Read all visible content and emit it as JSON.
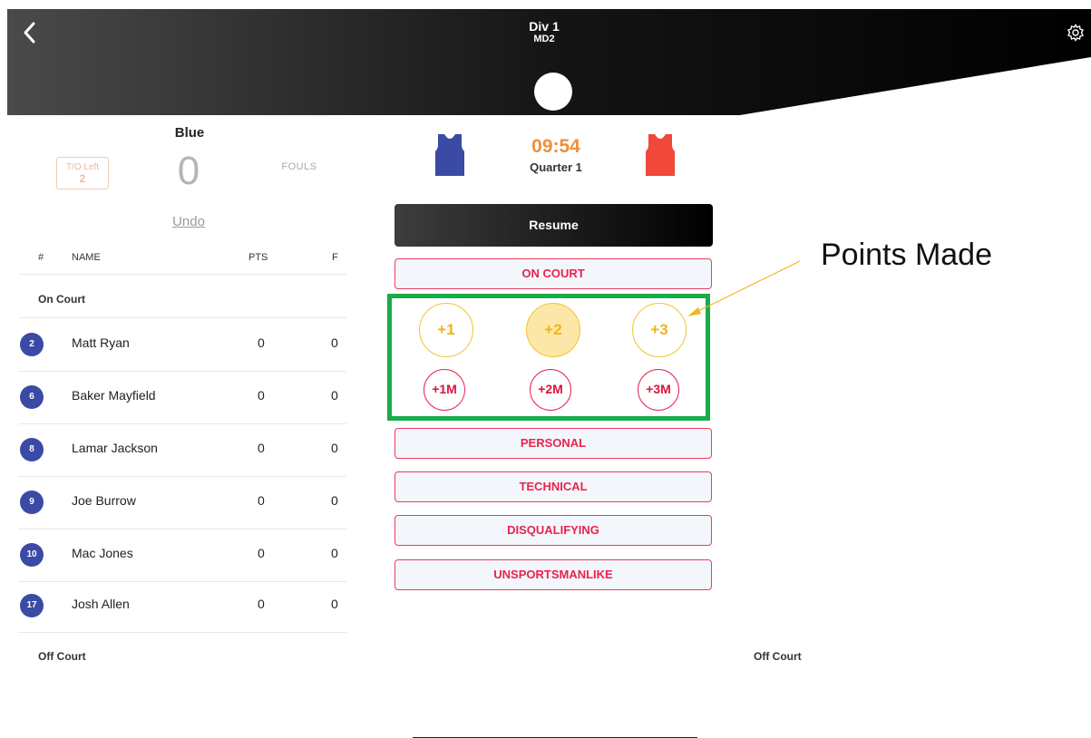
{
  "header": {
    "title": "Div 1",
    "subtitle": "MD2",
    "back_icon": "chevron-left-icon",
    "settings_icon": "gear-icon"
  },
  "team": {
    "name": "Blue",
    "timeouts_label": "T/O Left",
    "timeouts_value": "2",
    "score": "0",
    "fouls_label": "FOULS",
    "undo_label": "Undo"
  },
  "roster": {
    "columns": [
      "#",
      "NAME",
      "PTS",
      "F"
    ],
    "on_court_label": "On Court",
    "off_court_label": "Off Court",
    "players": [
      {
        "number": "2",
        "name": "Matt Ryan",
        "pts": "0",
        "fouls": "0"
      },
      {
        "number": "6",
        "name": "Baker Mayfield",
        "pts": "0",
        "fouls": "0"
      },
      {
        "number": "8",
        "name": "Lamar Jackson",
        "pts": "0",
        "fouls": "0"
      },
      {
        "number": "9",
        "name": "Joe Burrow",
        "pts": "0",
        "fouls": "0"
      },
      {
        "number": "10",
        "name": "Mac Jones",
        "pts": "0",
        "fouls": "0"
      },
      {
        "number": "17",
        "name": "Josh Allen",
        "pts": "0",
        "fouls": "0"
      }
    ]
  },
  "game": {
    "clock": "09:54",
    "period": "Quarter 1",
    "home_color": "#3a4aa5",
    "away_color": "#f0483a"
  },
  "actions": {
    "resume": "Resume",
    "on_court": "ON COURT",
    "points": [
      "+1",
      "+2",
      "+3"
    ],
    "misses": [
      "+1M",
      "+2M",
      "+3M"
    ],
    "personal": "PERSONAL",
    "technical": "TECHNICAL",
    "disqualifying": "DISQUALIFYING",
    "unsportsmanlike": "UNSPORTSMANLIKE"
  },
  "right_panel": {
    "off_court_label": "Off Court"
  },
  "annotation": {
    "text": "Points Made"
  },
  "colors": {
    "highlight_box": "#18ac4a",
    "points_accent": "#f3c233",
    "foul_accent": "#e8244e",
    "clock": "#ef8f3a"
  }
}
